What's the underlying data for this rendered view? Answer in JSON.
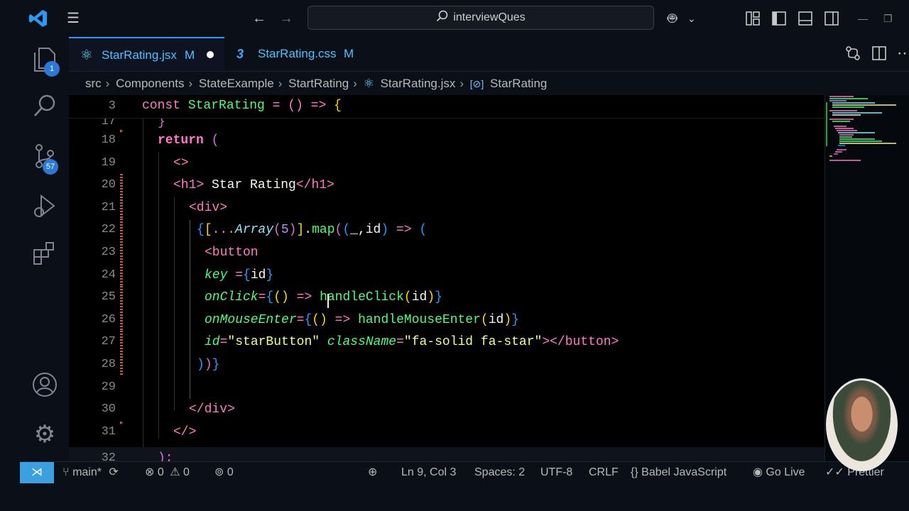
{
  "titlebar": {
    "search_text": "interviewQues",
    "icons": [
      "vscode-logo-icon",
      "menu-icon",
      "back-arrow-icon",
      "forward-arrow-icon",
      "search-icon",
      "copilot-icon",
      "chevron-down-icon",
      "customize-layout-icon",
      "toggle-sidebar-icon",
      "toggle-panel-icon",
      "toggle-secondary-sidebar-icon",
      "minimize-icon",
      "restore-icon"
    ]
  },
  "activity_bar": {
    "explorer_badge": "1",
    "source_control_badge": "57",
    "icons": [
      "files-icon",
      "search-icon",
      "source-control-icon",
      "run-debug-icon",
      "extensions-icon",
      "account-icon",
      "settings-gear-icon"
    ]
  },
  "tabs": [
    {
      "label": "StarRating.jsx",
      "status": "M",
      "dirty": true,
      "icon": "react-icon"
    },
    {
      "label": "StarRating.css",
      "status": "M",
      "dirty": false,
      "icon": "css-icon"
    }
  ],
  "breadcrumbs": [
    "src",
    "Components",
    "StateExample",
    "StartRating",
    "StarRating.jsx",
    "StarRating"
  ],
  "editor": {
    "sticky": {
      "line": "3",
      "code": {
        "kw": "const",
        "name": "StarRating",
        "op": "= () =>",
        "brace": "{"
      }
    },
    "partial_line_top": {
      "line": "17",
      "code": "}"
    },
    "partial_line_bottom": {
      "line": "32",
      "code": ");"
    },
    "lines": [
      {
        "n": "18",
        "tokens": [
          [
            "kw2",
            "return"
          ],
          [
            "txt",
            " "
          ],
          [
            "br2",
            "("
          ]
        ]
      },
      {
        "n": "19",
        "tokens": [
          [
            "tag",
            "<>"
          ]
        ]
      },
      {
        "n": "20",
        "tokens": [
          [
            "tag",
            "<h1>"
          ],
          [
            "txt",
            " Star Rating"
          ],
          [
            "tag",
            "</h1>"
          ]
        ]
      },
      {
        "n": "21",
        "tokens": [
          [
            "tag",
            "<div>"
          ]
        ]
      },
      {
        "n": "22",
        "tokens": [
          [
            "br3",
            "{"
          ],
          [
            "br1",
            "["
          ],
          [
            "op",
            "..."
          ],
          [
            "cls",
            "Array"
          ],
          [
            "br2",
            "("
          ],
          [
            "num",
            "5"
          ],
          [
            "br2",
            ")"
          ],
          [
            "br1",
            "]"
          ],
          [
            "vr",
            "."
          ],
          [
            "fn",
            "map"
          ],
          [
            "br2",
            "("
          ],
          [
            "br3",
            "("
          ],
          [
            "vr",
            "_,id"
          ],
          [
            "br3",
            ")"
          ],
          [
            "op",
            " => "
          ],
          [
            "br3",
            "("
          ]
        ]
      },
      {
        "n": "23",
        "tokens": [
          [
            "tag",
            "<button"
          ]
        ]
      },
      {
        "n": "24",
        "tokens": [
          [
            "attr",
            "key"
          ],
          [
            "op",
            " ="
          ],
          [
            "br3",
            "{"
          ],
          [
            "vr",
            "id"
          ],
          [
            "br3",
            "}"
          ]
        ]
      },
      {
        "n": "25",
        "tokens": [
          [
            "attr",
            "onClick"
          ],
          [
            "op",
            "="
          ],
          [
            "br3",
            "{"
          ],
          [
            "br1",
            "()"
          ],
          [
            "op",
            " => "
          ],
          [
            "fn",
            "handleClick"
          ],
          [
            "br1",
            "("
          ],
          [
            "vr",
            "id"
          ],
          [
            "br1",
            ")"
          ],
          [
            "br3",
            "}"
          ]
        ]
      },
      {
        "n": "26",
        "tokens": [
          [
            "attr",
            "onMouseEnter"
          ],
          [
            "op",
            "="
          ],
          [
            "br3",
            "{"
          ],
          [
            "br1",
            "()"
          ],
          [
            "op",
            " => "
          ],
          [
            "fn",
            "handleMouseEnter"
          ],
          [
            "br1",
            "("
          ],
          [
            "vr",
            "id"
          ],
          [
            "br1",
            ")"
          ],
          [
            "br3",
            "}"
          ]
        ]
      },
      {
        "n": "27",
        "tokens": [
          [
            "attr",
            "id"
          ],
          [
            "op",
            "="
          ],
          [
            "str",
            "\"starButton\""
          ],
          [
            "txt",
            " "
          ],
          [
            "attr",
            "className"
          ],
          [
            "op",
            "="
          ],
          [
            "str",
            "\"fa-solid fa-star\""
          ],
          [
            "tag",
            "></button>"
          ]
        ]
      },
      {
        "n": "28",
        "tokens": [
          [
            "br3",
            ")"
          ],
          [
            "br2",
            ")"
          ],
          [
            "br3",
            "}"
          ]
        ]
      },
      {
        "n": "29",
        "tokens": []
      },
      {
        "n": "30",
        "tokens": [
          [
            "tag",
            "</div>"
          ]
        ]
      },
      {
        "n": "31",
        "tokens": [
          [
            "tag",
            "</>"
          ]
        ]
      }
    ]
  },
  "statusbar": {
    "branch": "main*",
    "errors": "0",
    "warnings": "0",
    "ports": "0",
    "cursor_position": "Ln 9, Col 3",
    "indent": "Spaces: 2",
    "encoding": "UTF-8",
    "eol": "CRLF",
    "language": "Babel JavaScript",
    "go_live": "Go Live",
    "prettier": "Prettier"
  },
  "colors": {
    "accent": "#3794ff",
    "remote": "#3c9fe0",
    "keyword": "#ff79c6",
    "function": "#50fa7b",
    "string": "#f1fa8c"
  }
}
